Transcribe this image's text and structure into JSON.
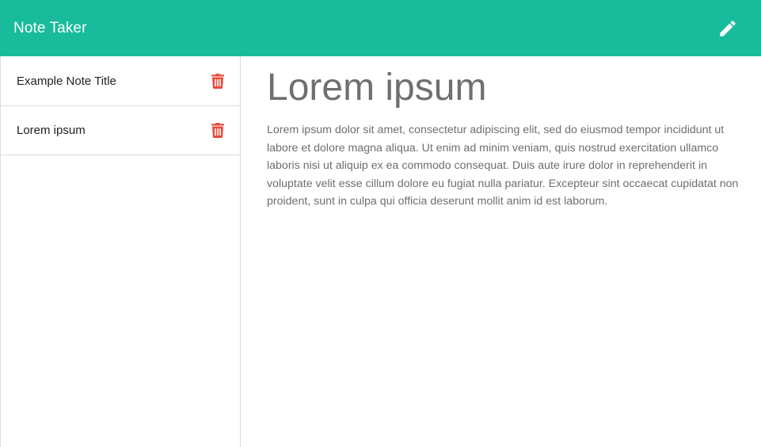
{
  "navbar": {
    "brand": "Note Taker",
    "new_note_icon": "pencil-icon",
    "background_color": "#18bc9c"
  },
  "sidebar": {
    "notes": [
      {
        "title": "Example Note Title",
        "delete_icon": "trash-icon"
      },
      {
        "title": "Lorem ipsum",
        "delete_icon": "trash-icon"
      }
    ],
    "delete_color": "#e74c3c"
  },
  "main": {
    "note_title": "Lorem ipsum",
    "note_text": "Lorem ipsum dolor sit amet, consectetur adipiscing elit, sed do eiusmod tempor incididunt ut labore et dolore magna aliqua. Ut enim ad minim veniam, quis nostrud exercitation ullamco laboris nisi ut aliquip ex ea commodo consequat. Duis aute irure dolor in reprehenderit in voluptate velit esse cillum dolore eu fugiat nulla pariatur. Excepteur sint occaecat cupidatat non proident, sunt in culpa qui officia deserunt mollit anim id est laborum."
  }
}
